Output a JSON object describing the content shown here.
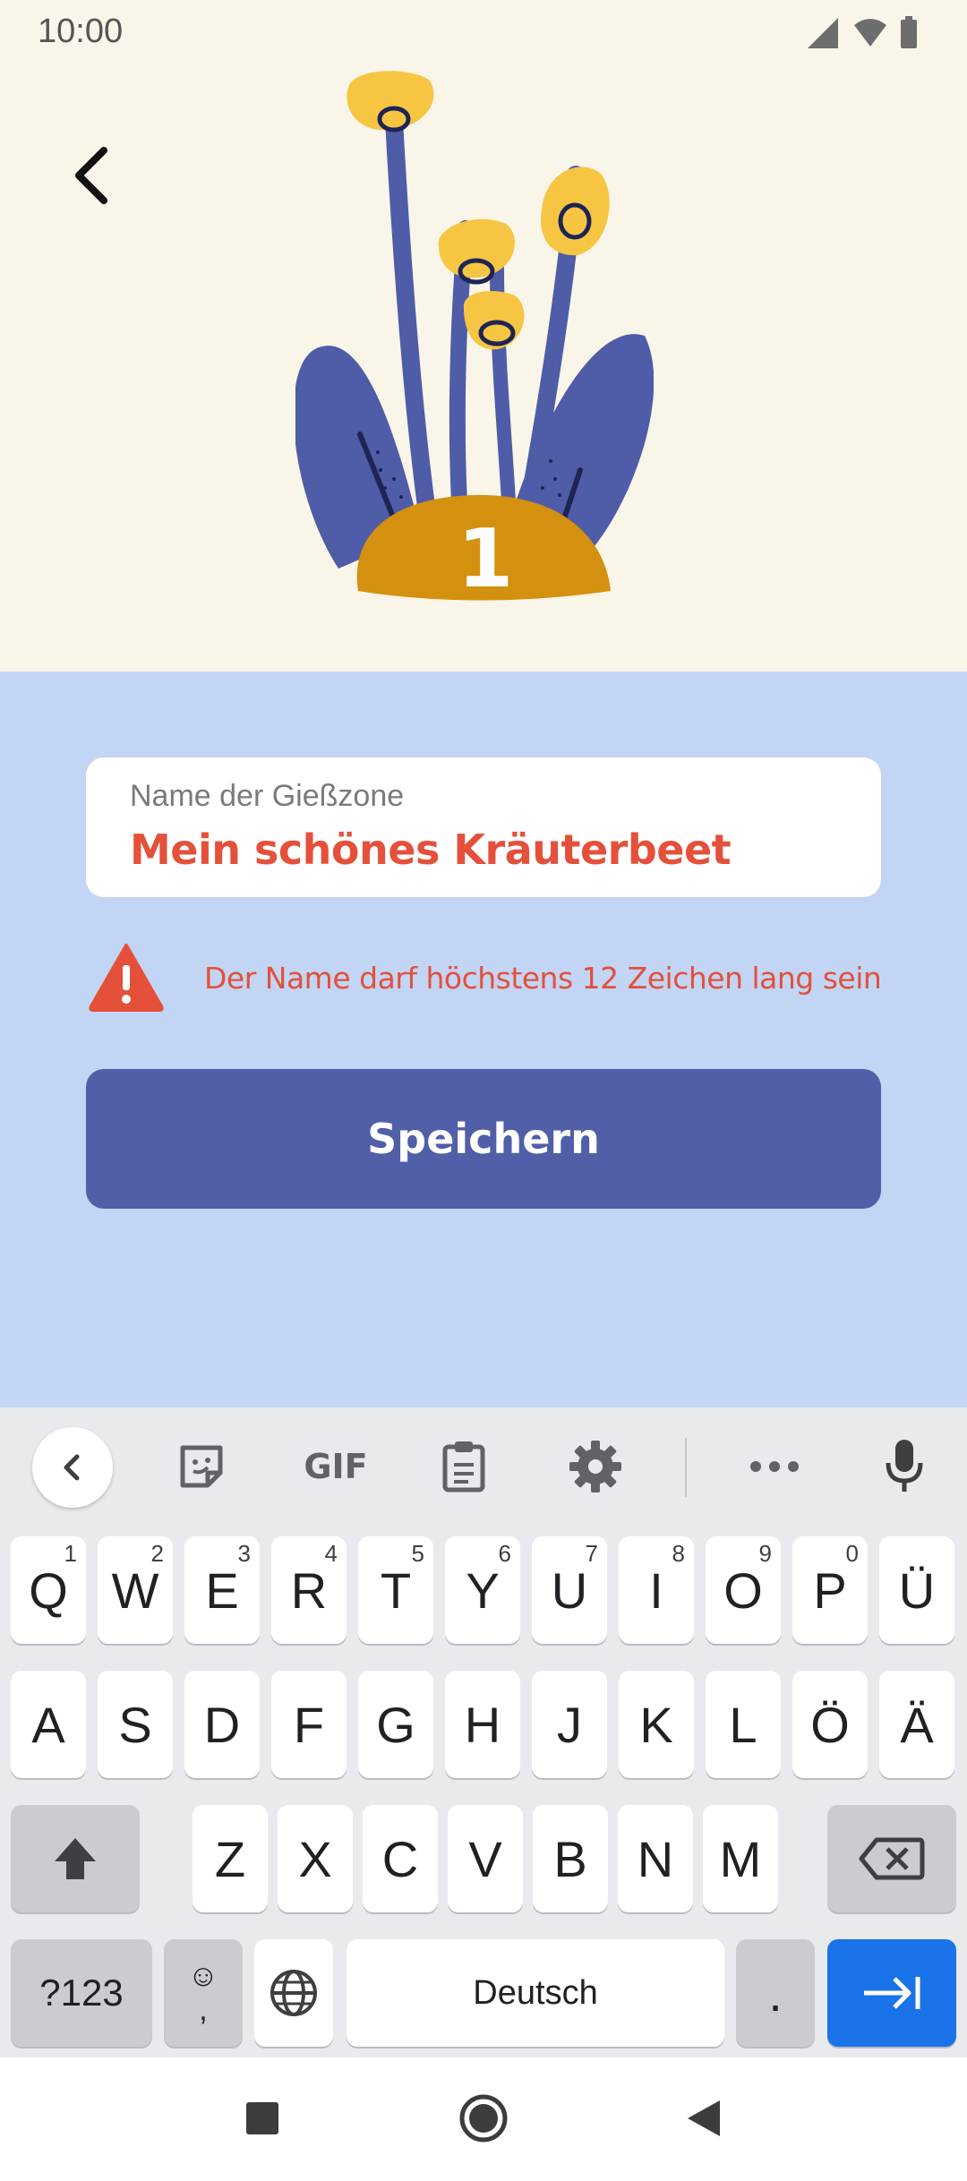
{
  "status_bar": {
    "time": "10:00",
    "icons": [
      "signal-icon",
      "wifi-icon",
      "battery-icon"
    ]
  },
  "header": {
    "back_icon": "chevron-left-icon",
    "illustration": "plant-illustration",
    "zone_number": "1"
  },
  "form": {
    "field_label": "Name der Gießzone",
    "field_value": "Mein schönes Kräuterbeet",
    "error_message": "Der Name darf höchstens 12 Zeichen lang sein",
    "save_label": "Speichern"
  },
  "keyboard": {
    "toolbar": [
      "back-icon",
      "sticker-icon",
      "GIF",
      "clipboard-icon",
      "settings-icon",
      "more-icon",
      "mic-icon"
    ],
    "gif_label": "GIF",
    "row1": [
      {
        "k": "Q",
        "h": "1"
      },
      {
        "k": "W",
        "h": "2"
      },
      {
        "k": "E",
        "h": "3"
      },
      {
        "k": "R",
        "h": "4"
      },
      {
        "k": "T",
        "h": "5"
      },
      {
        "k": "Y",
        "h": "6"
      },
      {
        "k": "U",
        "h": "7"
      },
      {
        "k": "I",
        "h": "8"
      },
      {
        "k": "O",
        "h": "9"
      },
      {
        "k": "P",
        "h": "0"
      },
      {
        "k": "Ü",
        "h": ""
      }
    ],
    "row2": [
      "A",
      "S",
      "D",
      "F",
      "G",
      "H",
      "J",
      "K",
      "L",
      "Ö",
      "Ä"
    ],
    "row3": [
      "Z",
      "X",
      "C",
      "V",
      "B",
      "N",
      "M"
    ],
    "symbols_label": "?123",
    "emoji_label": "☺",
    "comma_label": ",",
    "space_label": "Deutsch",
    "period_label": "."
  },
  "colors": {
    "top_bg": "#f9f5e8",
    "mid_bg": "#c2d5f5",
    "error": "#e4503a",
    "button": "#515ea8",
    "enter": "#1a73e8"
  },
  "nav_bar": [
    "recents-icon",
    "home-icon",
    "back-icon"
  ]
}
